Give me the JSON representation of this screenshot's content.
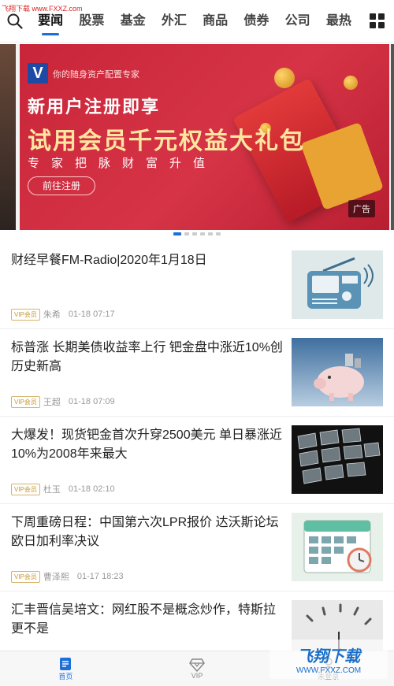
{
  "watermark_top": "飞翔下载 www.FXXZ.com",
  "nav": {
    "tabs": [
      {
        "label": "要闻"
      },
      {
        "label": "股票"
      },
      {
        "label": "基金"
      },
      {
        "label": "外汇"
      },
      {
        "label": "商品"
      },
      {
        "label": "债券"
      },
      {
        "label": "公司"
      },
      {
        "label": "最热"
      }
    ],
    "accent_color": "#1e6fd9"
  },
  "banner": {
    "logo_letter": "V",
    "slogan": "你的随身资产配置专家",
    "line1": "新用户注册即享",
    "line2": "试用会员千元权益大礼包",
    "line3": "专家把脉财富升值",
    "cta": "前往注册",
    "ad_label": "广告",
    "page_count": 6,
    "active_page": 1
  },
  "news": [
    {
      "title": "财经早餐FM-Radio|2020年1月18日",
      "tag": "VIP会员",
      "author": "朱希",
      "time": "01-18 07:17",
      "thumb": "radio"
    },
    {
      "title": "标普涨 长期美债收益率上行 钯金盘中涨近10%创历史新高",
      "tag": "VIP会员",
      "author": "王超",
      "time": "01-18 07:09",
      "thumb": "piggy-bank"
    },
    {
      "title": "大爆发！现货钯金首次升穿2500美元 单日暴涨近10%为2008年来最大",
      "tag": "VIP会员",
      "author": "杜玉",
      "time": "01-18 02:10",
      "thumb": "screens"
    },
    {
      "title": "下周重磅日程：中国第六次LPR报价 达沃斯论坛 欧日加利率决议",
      "tag": "VIP会员",
      "author": "曹泽熙",
      "time": "01-17 18:23",
      "thumb": "calendar"
    },
    {
      "title": "汇丰晋信吴培文：网红股不是概念炒作，特斯拉更不是",
      "tag": "",
      "author": "",
      "time": "",
      "thumb": "clock"
    }
  ],
  "bottom_nav": [
    {
      "label": "首页",
      "icon": "home-doc-icon"
    },
    {
      "label": "VIP",
      "icon": "diamond-icon"
    },
    {
      "label": "未登录",
      "icon": "user-icon"
    }
  ],
  "watermark_bottom": {
    "big": "飞翔下载",
    "small": "WWW.FXXZ.COM"
  }
}
